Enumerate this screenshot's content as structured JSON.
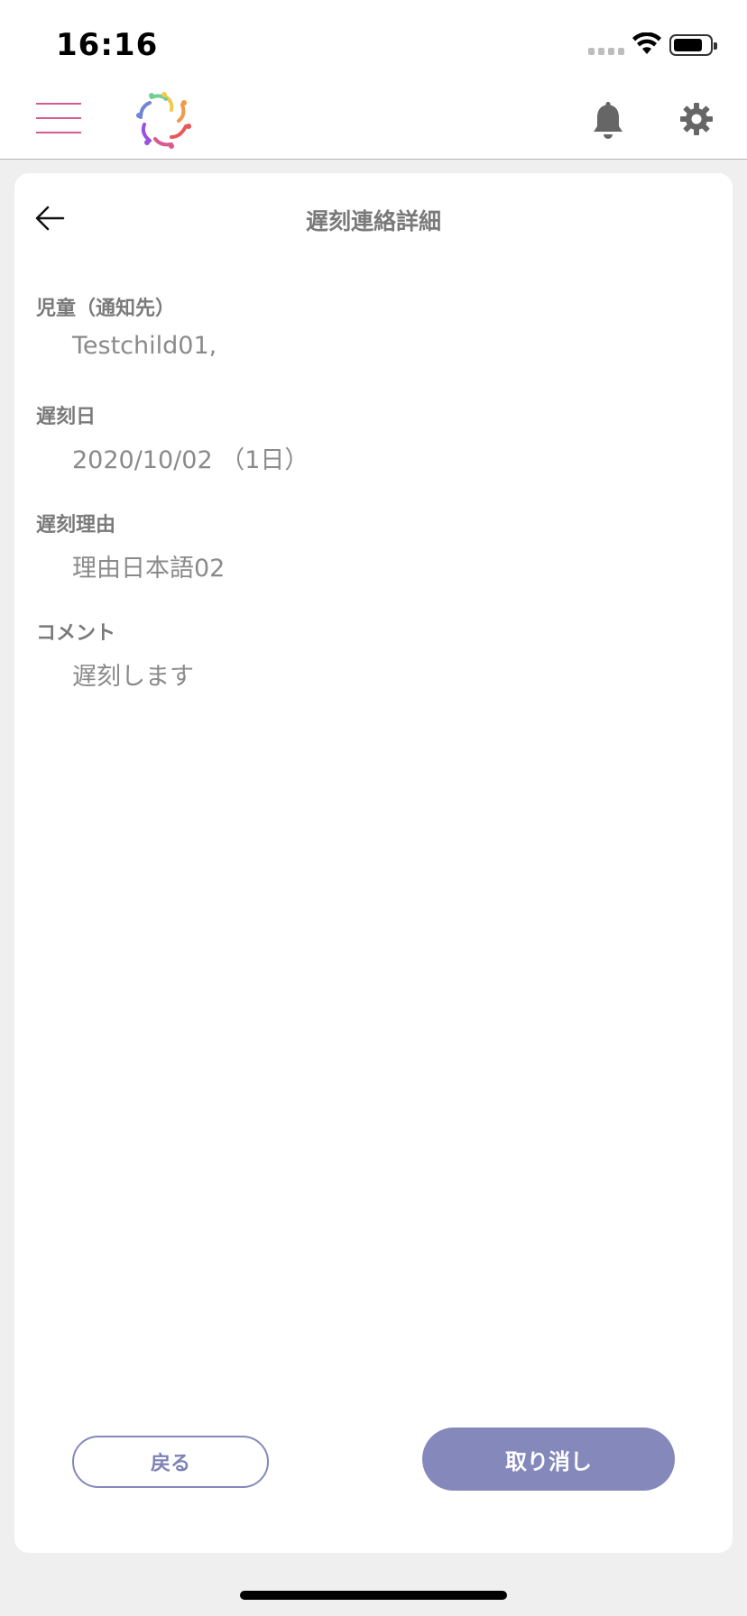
{
  "status_bar": {
    "time": "16:16"
  },
  "header": {
    "menu_icon": "hamburger-menu-icon",
    "logo": "flower-logo",
    "bell_icon": "bell-icon",
    "settings_icon": "gear-icon",
    "accent_color": "#d85b8f"
  },
  "page": {
    "title": "遅刻連絡詳細",
    "back_icon": "arrow-left-icon"
  },
  "fields": [
    {
      "label": "児童（通知先）",
      "value": "Testchild01,"
    },
    {
      "label": "遅刻日",
      "value": "2020/10/02 （1日）"
    },
    {
      "label": "遅刻理由",
      "value": "理由日本語02"
    },
    {
      "label": "コメント",
      "value": "遅刻します"
    }
  ],
  "buttons": {
    "back_label": "戻る",
    "cancel_label": "取り消し",
    "primary_color": "#8488bb"
  }
}
